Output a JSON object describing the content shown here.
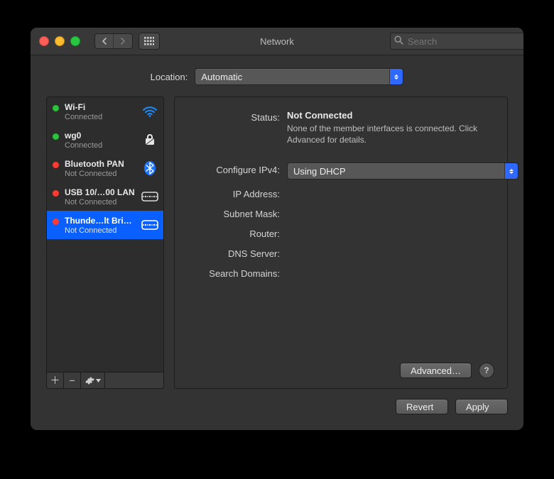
{
  "window": {
    "title": "Network"
  },
  "search": {
    "placeholder": "Search"
  },
  "location": {
    "label": "Location:",
    "value": "Automatic"
  },
  "sidebar": {
    "items": [
      {
        "name": "Wi-Fi",
        "sub": "Connected",
        "status": "green",
        "icon": "wifi",
        "selected": false
      },
      {
        "name": "wg0",
        "sub": "Connected",
        "status": "green",
        "icon": "lock",
        "selected": false
      },
      {
        "name": "Bluetooth PAN",
        "sub": "Not Connected",
        "status": "red",
        "icon": "bt",
        "selected": false
      },
      {
        "name": "USB 10/…00 LAN",
        "sub": "Not Connected",
        "status": "red",
        "icon": "eth",
        "selected": false
      },
      {
        "name": "Thunde…lt Bridge",
        "sub": "Not Connected",
        "status": "red",
        "icon": "eth",
        "selected": true
      }
    ]
  },
  "detail": {
    "status": {
      "label": "Status:",
      "value": "Not Connected",
      "sub": "None of the member interfaces is connected. Click Advanced for details."
    },
    "configure": {
      "label": "Configure IPv4:",
      "value": "Using DHCP"
    },
    "ip": {
      "label": "IP Address:",
      "value": ""
    },
    "subnet": {
      "label": "Subnet Mask:",
      "value": ""
    },
    "router": {
      "label": "Router:",
      "value": ""
    },
    "dns": {
      "label": "DNS Server:",
      "value": ""
    },
    "searchdomains": {
      "label": "Search Domains:",
      "value": ""
    },
    "advanced_label": "Advanced…"
  },
  "footer": {
    "revert": "Revert",
    "apply": "Apply"
  }
}
